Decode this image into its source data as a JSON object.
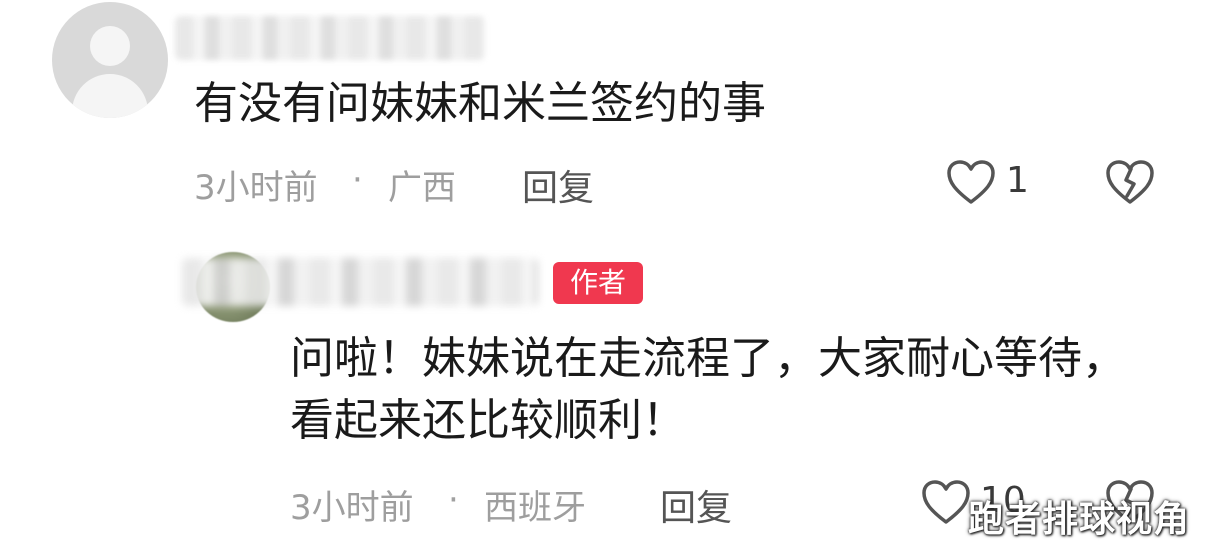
{
  "comment": {
    "text": "有没有问妹妹和米兰签约的事",
    "time": "3小时前",
    "separator": "·",
    "location": "广西",
    "reply_label": "回复",
    "like_count": "1",
    "icons": {
      "avatar": "default-avatar-icon",
      "like": "heart-outline-icon",
      "dislike": "broken-heart-icon"
    }
  },
  "reply": {
    "author_badge": "作者",
    "text": "问啦！妹妹说在走流程了，大家耐心等待，看起来还比较顺利！",
    "time": "3小时前",
    "separator": "·",
    "location": "西班牙",
    "reply_label": "回复",
    "like_count": "10",
    "icons": {
      "like": "heart-outline-icon",
      "dislike": "broken-heart-icon"
    }
  },
  "watermark": "跑者排球视角",
  "colors": {
    "badge": "#f0384f",
    "meta": "#9e9e9e",
    "text": "#1a1a1a"
  }
}
